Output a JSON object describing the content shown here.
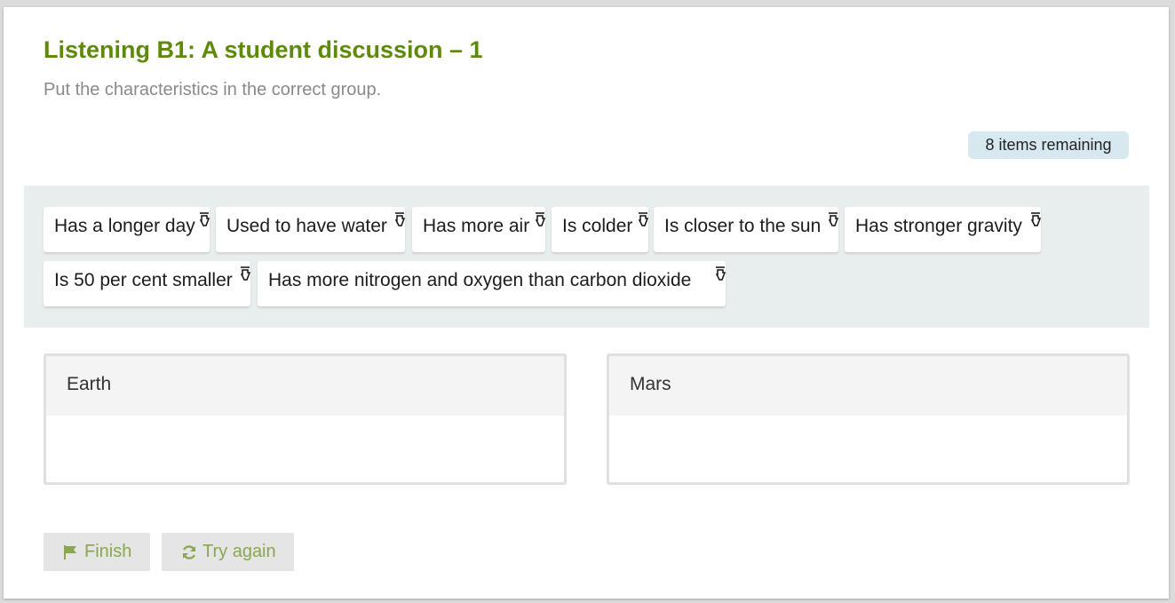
{
  "title": "Listening B1: A student discussion – 1",
  "instruction": "Put the characteristics in the correct group.",
  "remaining": "8 items remaining",
  "items": [
    "Has a longer day",
    "Used to have water",
    "Has more air",
    "Is colder",
    "Is closer to the sun",
    "Has stronger gravity",
    "Is 50 per cent smaller",
    "Has more nitrogen and oxygen than carbon dioxide"
  ],
  "zones": [
    "Earth",
    "Mars"
  ],
  "buttons": {
    "finish": "Finish",
    "try_again": "Try again"
  },
  "colors": {
    "title": "#5e8a0a",
    "button_text": "#8aa651",
    "badge_bg": "#d7e8f1",
    "pool_bg": "#e8edee"
  },
  "icons": {
    "chip": "grab-hand-icon",
    "finish": "flag-icon",
    "try_again": "refresh-icon"
  }
}
